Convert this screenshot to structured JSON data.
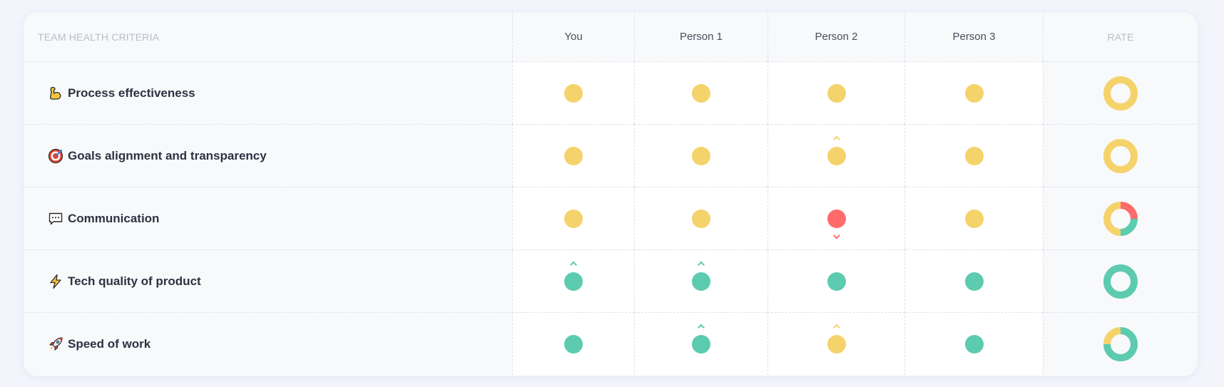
{
  "colors": {
    "yellow": "#f5d36b",
    "red": "#ff6b6b",
    "green": "#5ccbb0"
  },
  "header": {
    "criteria_label": "TEAM HEALTH CRITERIA",
    "people": [
      "You",
      "Person 1",
      "Person 2",
      "Person 3"
    ],
    "rate_label": "RATE"
  },
  "rows": [
    {
      "icon": "flexed-biceps-icon",
      "label": "Process effectiveness",
      "votes": [
        {
          "status": "yellow",
          "trend": "none"
        },
        {
          "status": "yellow",
          "trend": "none"
        },
        {
          "status": "yellow",
          "trend": "none"
        },
        {
          "status": "yellow",
          "trend": "none"
        }
      ],
      "rate": {
        "green": 0,
        "yellow": 1,
        "red": 0
      }
    },
    {
      "icon": "direct-hit-target-icon",
      "label": "Goals alignment and transparency",
      "votes": [
        {
          "status": "yellow",
          "trend": "none"
        },
        {
          "status": "yellow",
          "trend": "none"
        },
        {
          "status": "yellow",
          "trend": "up"
        },
        {
          "status": "yellow",
          "trend": "none"
        }
      ],
      "rate": {
        "green": 0,
        "yellow": 1,
        "red": 0
      }
    },
    {
      "icon": "speech-bubble-icon",
      "label": "Communication",
      "votes": [
        {
          "status": "yellow",
          "trend": "none"
        },
        {
          "status": "yellow",
          "trend": "none"
        },
        {
          "status": "red",
          "trend": "down"
        },
        {
          "status": "yellow",
          "trend": "none"
        }
      ],
      "rate": {
        "green": 0.25,
        "yellow": 0.5,
        "red": 0.25
      }
    },
    {
      "icon": "lightning-bolt-icon",
      "label": "Tech quality of product",
      "votes": [
        {
          "status": "green",
          "trend": "up"
        },
        {
          "status": "green",
          "trend": "up"
        },
        {
          "status": "green",
          "trend": "none"
        },
        {
          "status": "green",
          "trend": "none"
        }
      ],
      "rate": {
        "green": 1,
        "yellow": 0,
        "red": 0
      }
    },
    {
      "icon": "rocket-icon",
      "label": "Speed of work",
      "votes": [
        {
          "status": "green",
          "trend": "none"
        },
        {
          "status": "green",
          "trend": "up"
        },
        {
          "status": "yellow",
          "trend": "up"
        },
        {
          "status": "green",
          "trend": "none"
        }
      ],
      "rate": {
        "green": 0.75,
        "yellow": 0.25,
        "red": 0
      }
    }
  ]
}
